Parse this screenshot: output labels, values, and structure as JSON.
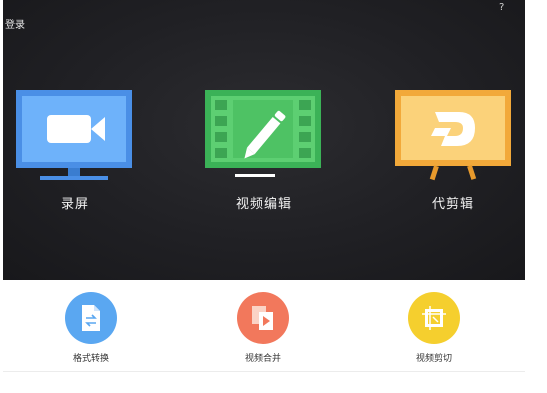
{
  "header": {
    "login_label": "登录",
    "help_label": "?"
  },
  "main_tiles": [
    {
      "label": "录屏",
      "icon": "screen-record-icon",
      "color": "#5aa3f5"
    },
    {
      "label": "视频编辑",
      "icon": "video-edit-icon",
      "color": "#55c86a"
    },
    {
      "label": "代剪辑",
      "icon": "agency-edit-icon",
      "color": "#f7c35c"
    }
  ],
  "tools": [
    {
      "label": "格式转换",
      "icon": "format-convert-icon",
      "color": "#5aa7f1"
    },
    {
      "label": "视频合并",
      "icon": "video-merge-icon",
      "color": "#f2785c"
    },
    {
      "label": "视频剪切",
      "icon": "video-cut-icon",
      "color": "#f5cf2e"
    }
  ]
}
